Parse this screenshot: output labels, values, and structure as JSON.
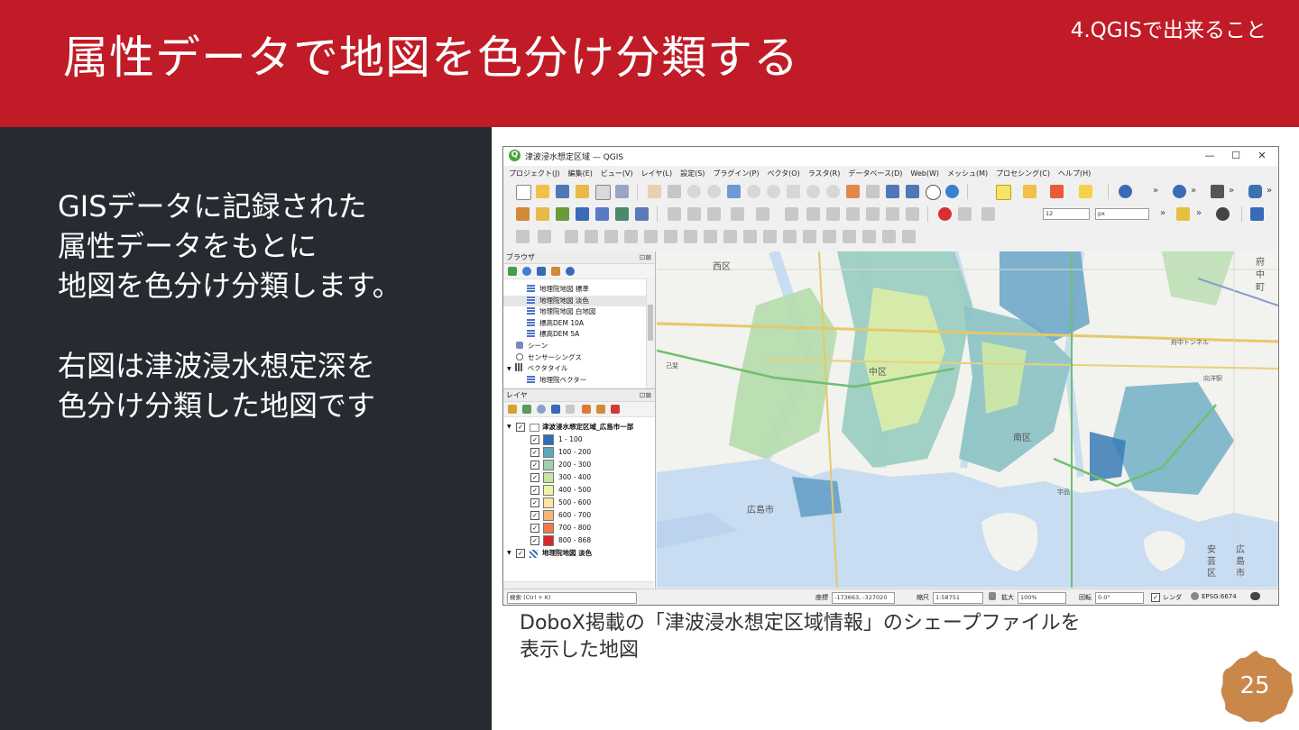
{
  "slide": {
    "title": "属性データで地図を色分け分類する",
    "section": "4.QGISで出来ること",
    "body": "GISデータに記録された\n属性データをもとに\n地図を色分け分類します。\n\n右図は津波浸水想定深を\n色分け分類した地図です",
    "caption": "DoboX掲載の「津波浸水想定区域情報」のシェープファイルを\n表示した地図",
    "page_number": "25",
    "colors": {
      "header": "#c01b26",
      "left_panel": "#262a31",
      "badge": "#c9884a"
    }
  },
  "qgis": {
    "window_title": "津波浸水想定区域 — QGIS",
    "app_icon": "Q",
    "window_controls": [
      "—",
      "☐",
      "✕"
    ],
    "menu": [
      "プロジェクト(J)",
      "編集(E)",
      "ビュー(V)",
      "レイヤ(L)",
      "設定(S)",
      "プラグイン(P)",
      "ベクタ(O)",
      "ラスタ(R)",
      "データベース(D)",
      "Web(W)",
      "メッシュ(M)",
      "プロセシング(C)",
      "ヘルプ(H)"
    ],
    "toolbar_more": "»",
    "font_size_value": "12",
    "font_unit": "px",
    "browser_panel": {
      "title": "ブラウザ",
      "controls": "⊡⊠",
      "items": [
        {
          "label": "地理院地図 標準",
          "icon": "grid"
        },
        {
          "label": "地理院地図 淡色",
          "icon": "grid"
        },
        {
          "label": "地理院地図 白地図",
          "icon": "grid"
        },
        {
          "label": "標高DEM 10A",
          "icon": "grid"
        },
        {
          "label": "標高DEM 5A",
          "icon": "grid"
        },
        {
          "label": "シーン",
          "icon": "scene"
        },
        {
          "label": "センサーシングス",
          "icon": "sensor"
        },
        {
          "label": "ベクタタイル",
          "icon": "vectortile"
        },
        {
          "label": "地理院ベクター",
          "icon": "grid"
        }
      ]
    },
    "layers_panel": {
      "title": "レイヤ",
      "controls": "⊡⊠",
      "group_layer": "津波浸水想定区域_広島市一部",
      "legend": [
        {
          "label": "1 - 100",
          "color": "#2f6fb3"
        },
        {
          "label": "100 - 200",
          "color": "#5fa8b9"
        },
        {
          "label": "200 - 300",
          "color": "#9ed1b0"
        },
        {
          "label": "300 - 400",
          "color": "#c8e6a0"
        },
        {
          "label": "400 - 500",
          "color": "#eef2a6"
        },
        {
          "label": "500 - 600",
          "color": "#fde2a0"
        },
        {
          "label": "600 - 700",
          "color": "#f8b577"
        },
        {
          "label": "700 - 800",
          "color": "#ee7a4e"
        },
        {
          "label": "800 - 868",
          "color": "#d8262b"
        }
      ],
      "base_layer": "地理院地図 淡色"
    },
    "map_labels": {
      "nishi_ku": "西区",
      "fuchu": "府中町",
      "naka_ku": "中区",
      "minami_ku": "南区",
      "hiroshima_city": "広島市",
      "aki_ku": "安芸区",
      "hiroshima_city_v": "広島市",
      "fuchu_tunnel": "府中トンネル",
      "mukainada": "向洋駅",
      "koi": "己斐",
      "ujina": "宇品"
    },
    "status": {
      "search_placeholder": "検索 (Ctrl + K)",
      "coordinate_label": "座標",
      "coordinate_value": "-173663, -327020",
      "scale_label": "縮尺",
      "scale_value": "1:58751",
      "magnifier_label": "拡大",
      "magnifier_value": "100%",
      "rotation_label": "回転",
      "rotation_value": "0.0°",
      "render_label": "レンダ",
      "crs": "EPSG:6674"
    }
  }
}
